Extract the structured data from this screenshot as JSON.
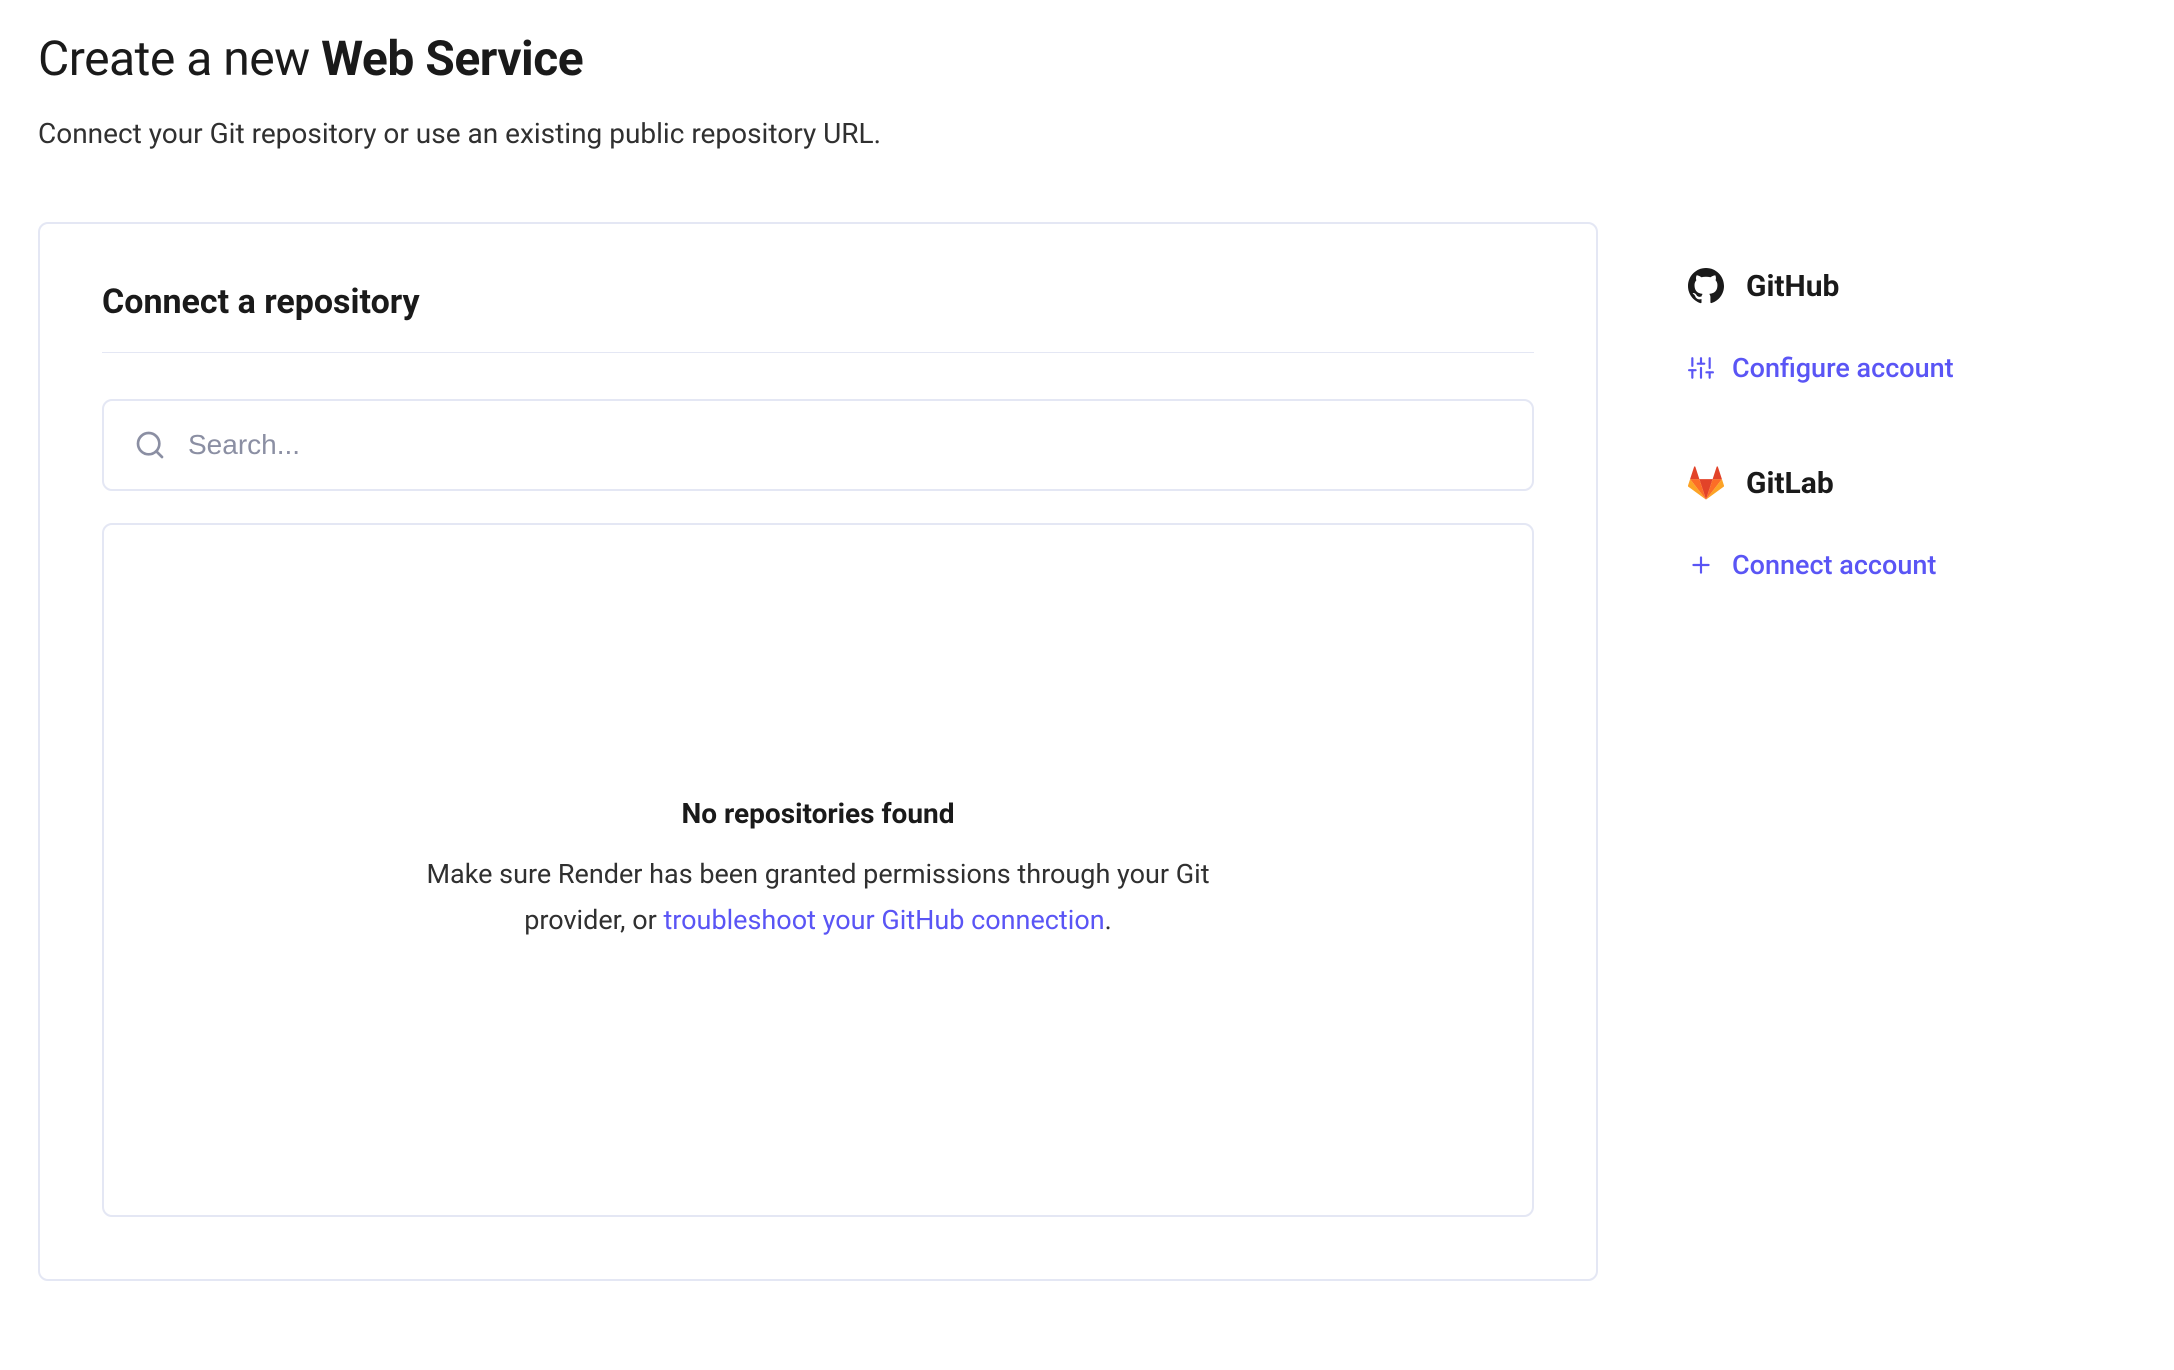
{
  "header": {
    "title_prefix": "Create a new ",
    "title_strong": "Web Service",
    "subtitle": "Connect your Git repository or use an existing public repository URL."
  },
  "main": {
    "section_heading": "Connect a repository",
    "search": {
      "placeholder": "Search..."
    },
    "empty": {
      "title": "No repositories found",
      "body_prefix": "Make sure Render has been granted permissions through your Git provider, or ",
      "link_text": "troubleshoot your GitHub connection",
      "body_suffix": "."
    }
  },
  "sidebar": {
    "providers": [
      {
        "name": "GitHub",
        "action_label": "Configure account"
      },
      {
        "name": "GitLab",
        "action_label": "Connect account"
      }
    ]
  }
}
